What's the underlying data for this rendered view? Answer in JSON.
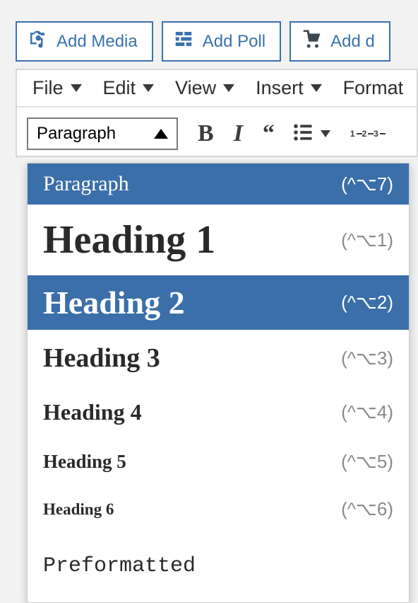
{
  "topButtons": {
    "media": "Add Media",
    "poll": "Add Poll",
    "dynamic": "Add d"
  },
  "menubar": {
    "file": "File",
    "edit": "Edit",
    "view": "View",
    "insert": "Insert",
    "format": "Format"
  },
  "toolbar": {
    "formatSelectValue": "Paragraph"
  },
  "formatDropdown": {
    "items": [
      {
        "label": "Paragraph",
        "shortcut": "(^⌥7)",
        "style": "dd-paragraph",
        "selected": true
      },
      {
        "label": "Heading 1",
        "shortcut": "(^⌥1)",
        "style": "dd-h1",
        "selected": false
      },
      {
        "label": "Heading 2",
        "shortcut": "(^⌥2)",
        "style": "dd-h2",
        "selected": true
      },
      {
        "label": "Heading 3",
        "shortcut": "(^⌥3)",
        "style": "dd-h3",
        "selected": false
      },
      {
        "label": "Heading 4",
        "shortcut": "(^⌥4)",
        "style": "dd-h4",
        "selected": false
      },
      {
        "label": "Heading 5",
        "shortcut": "(^⌥5)",
        "style": "dd-h5",
        "selected": false
      },
      {
        "label": "Heading 6",
        "shortcut": "(^⌥6)",
        "style": "dd-h6",
        "selected": false
      },
      {
        "label": "Preformatted",
        "shortcut": "",
        "style": "dd-pre",
        "selected": false
      }
    ]
  }
}
